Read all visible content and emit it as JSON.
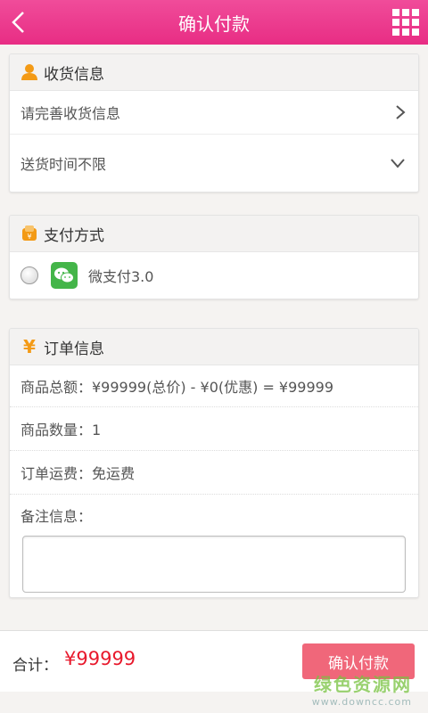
{
  "header": {
    "title": "确认付款",
    "back_icon": "chevron-left-icon",
    "menu_icon": "grid-menu-icon"
  },
  "delivery": {
    "title": "收货信息",
    "address_placeholder": "请完善收货信息",
    "time_text": "送货时间不限"
  },
  "payment": {
    "title": "支付方式",
    "option_label": "微支付3.0"
  },
  "order": {
    "title": "订单信息",
    "icon_char": "¥",
    "total_text": "商品总额：¥99999(总价) - ¥0(优惠) = ¥99999",
    "quantity_text": "商品数量：1",
    "shipping_text": "订单运费：免运费",
    "remarks_label": "备注信息："
  },
  "footer": {
    "total_label": "合计：",
    "total_value": "¥99999",
    "confirm_label": "确认付款"
  },
  "watermark": {
    "line1": "绿色资源网",
    "line2": "www.downcc.com"
  },
  "colors": {
    "header": "#e82d84",
    "accent_price": "#e8192c",
    "confirm_button": "#f0677a",
    "wechat_green": "#44b549"
  }
}
